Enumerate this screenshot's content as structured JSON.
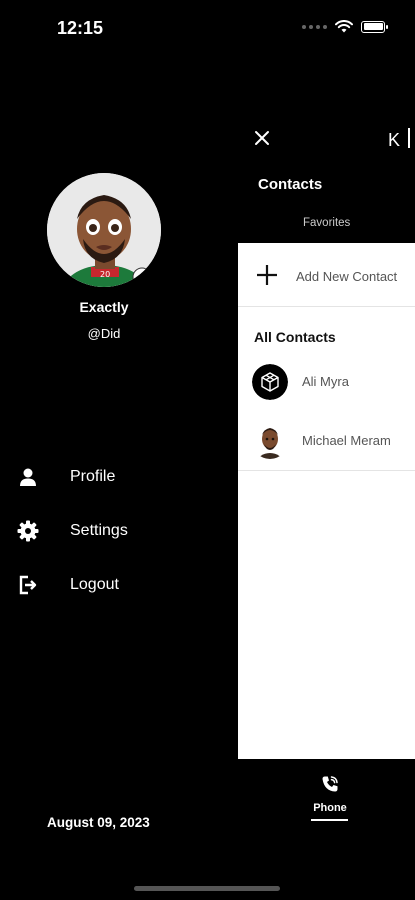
{
  "status_bar": {
    "time": "12:15"
  },
  "drawer": {
    "profile_name": "Exactly",
    "profile_handle": "@Did",
    "menu": [
      {
        "label": "Profile",
        "icon": "person-icon"
      },
      {
        "label": "Settings",
        "icon": "gear-icon"
      },
      {
        "label": "Logout",
        "icon": "logout-icon"
      }
    ],
    "date": "August 09, 2023"
  },
  "main": {
    "title": "Contacts",
    "header_right": "K",
    "favorites_tab": "Favorites",
    "add_new_contact": "Add New Contact",
    "all_contacts_heading": "All Contacts",
    "contacts": [
      {
        "name": "Ali Myra",
        "avatar": "cube-logo-avatar"
      },
      {
        "name": "Michael Meram",
        "avatar": "person-photo-avatar"
      }
    ],
    "bottom_tab": {
      "label": "Phone",
      "icon": "phone-icon"
    }
  },
  "colors": {
    "background": "#000000",
    "panel": "#ffffff",
    "text_dark": "#222222"
  }
}
